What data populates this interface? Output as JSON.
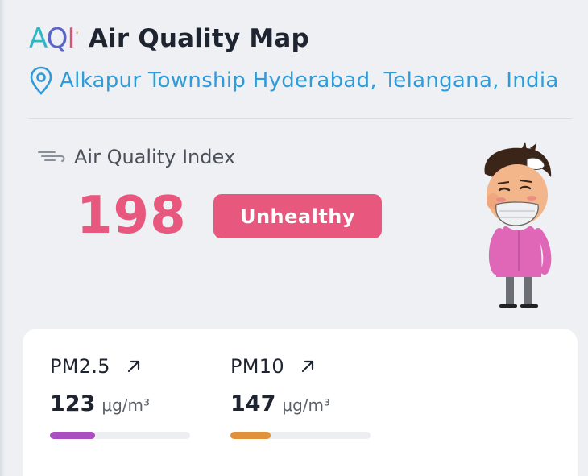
{
  "header": {
    "logo_text": "AQI",
    "title": "Air Quality Map"
  },
  "location": {
    "text": "Alkapur Township Hyderabad, Telangana, India"
  },
  "aqi": {
    "label": "Air Quality Index",
    "value": "198",
    "status": "Unhealthy",
    "status_color": "#e8577d"
  },
  "pollutants": [
    {
      "name": "PM2.5",
      "value": "123",
      "unit": "μg/m³",
      "bar_color": "#a94fc0",
      "level_fraction": 0.32
    },
    {
      "name": "PM10",
      "value": "147",
      "unit": "μg/m³",
      "bar_color": "#e0913a",
      "level_fraction": 0.29
    }
  ],
  "icons": {
    "location": "location-pin-icon",
    "wind": "wind-icon",
    "trend": "arrow-up-right-icon"
  },
  "colors": {
    "accent_blue": "#2f9bd8",
    "aqi_pink": "#e8577d"
  }
}
